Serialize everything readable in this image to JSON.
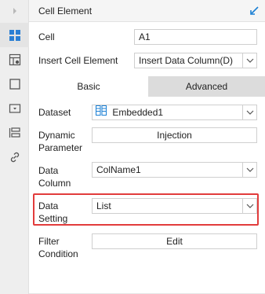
{
  "panel": {
    "title": "Cell Element"
  },
  "rail": {
    "icons": [
      "expand-arrow-icon",
      "cell-element-icon",
      "cell-attribute-icon",
      "float-element-icon",
      "widget-icon",
      "condition-attribute-icon",
      "hyperlink-icon"
    ]
  },
  "cell": {
    "label": "Cell",
    "value": "A1"
  },
  "insert": {
    "label": "Insert Cell Element",
    "value": "Insert Data Column(D)"
  },
  "tabs": {
    "basic": "Basic",
    "advanced": "Advanced"
  },
  "dataset": {
    "label": "Dataset",
    "value": "Embedded1"
  },
  "dynamic": {
    "label_line1": "Dynamic",
    "label_line2": "Parameter",
    "button": "Injection"
  },
  "data_column": {
    "label_line1": "Data",
    "label_line2": "Column",
    "value": "ColName1"
  },
  "data_setting": {
    "label_line1": "Data",
    "label_line2": "Setting",
    "value": "List"
  },
  "filter": {
    "label_line1": "Filter",
    "label_line2": "Condition",
    "button": "Edit"
  },
  "colors": {
    "accent": "#1a7fd4",
    "highlight": "#e23c3c",
    "tab_inactive": "#dcdcdc"
  }
}
